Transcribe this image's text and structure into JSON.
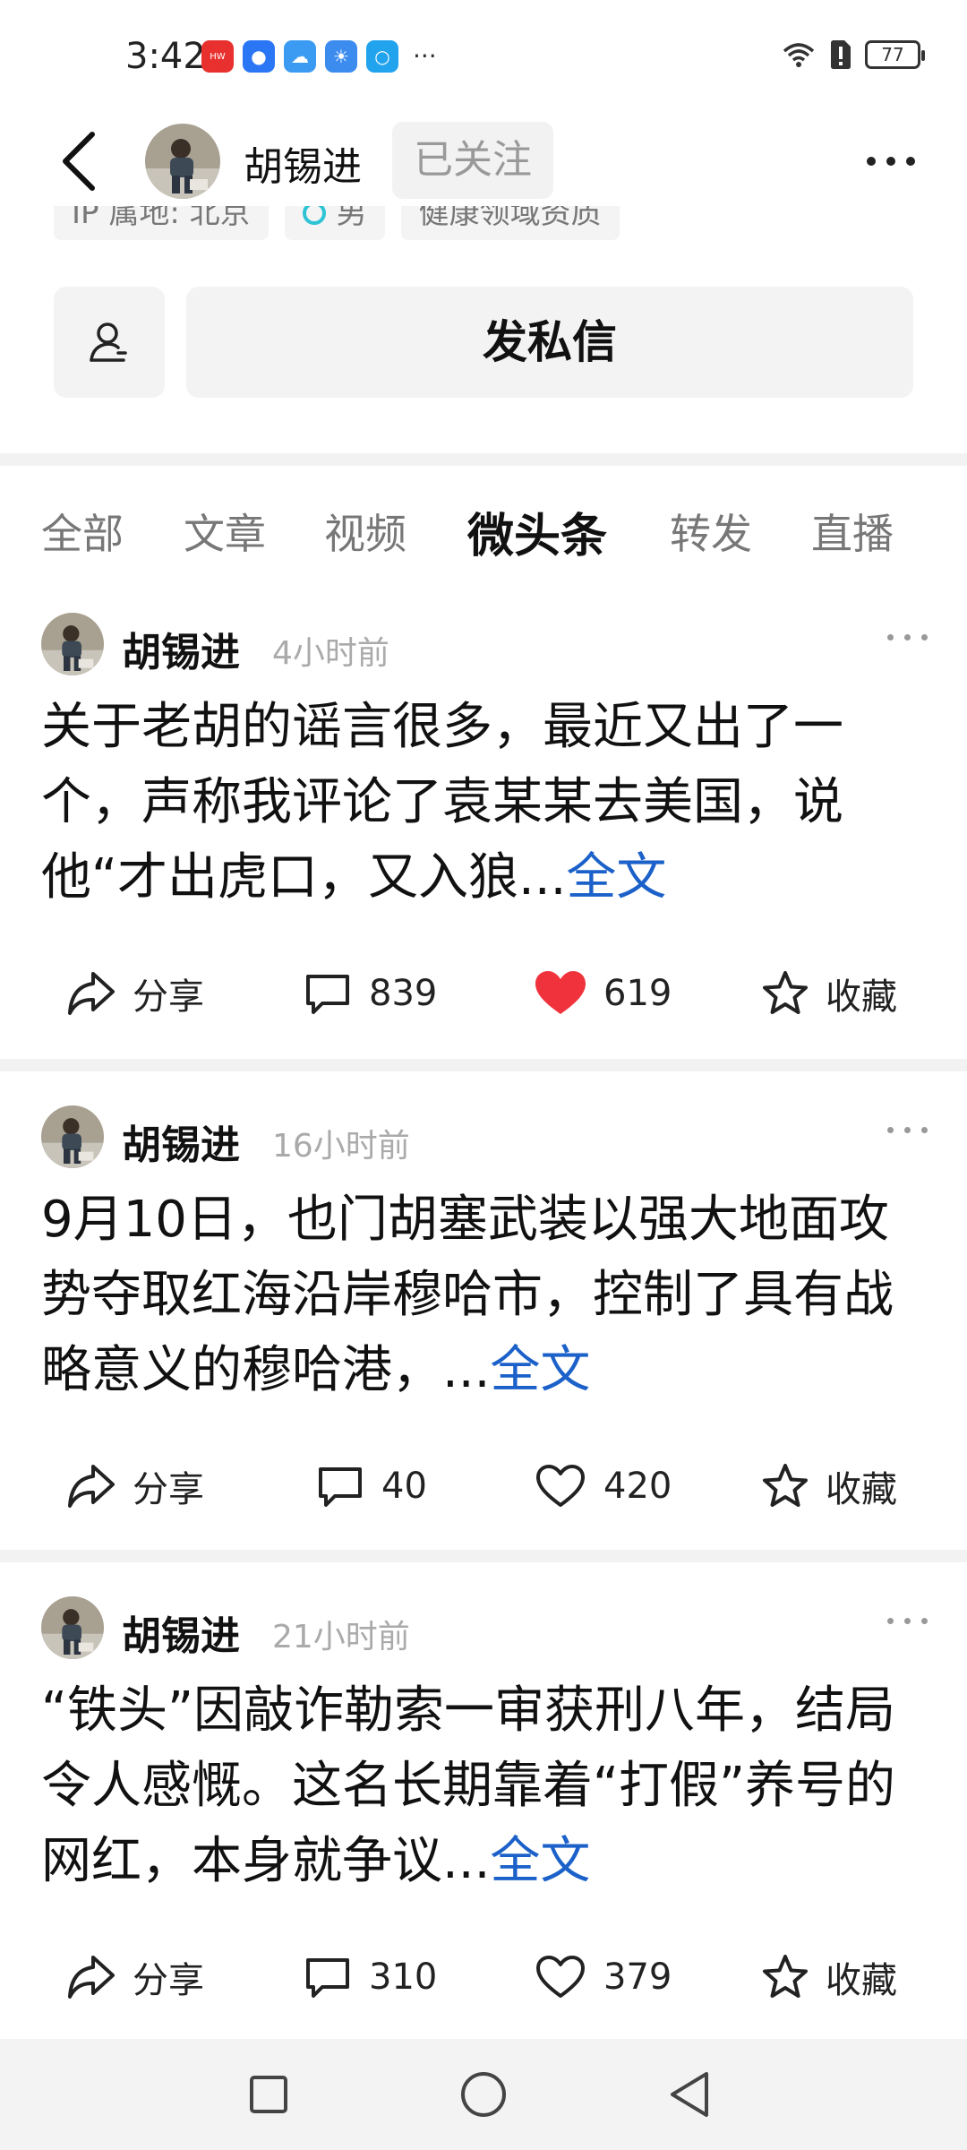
{
  "status_bar": {
    "time": "3:42",
    "battery": "77"
  },
  "header": {
    "name": "胡锡进",
    "follow_label": "已关注"
  },
  "profile_tags": [
    {
      "label": "IP 属地: 北京"
    },
    {
      "label": "男"
    },
    {
      "label": "健康领域资质"
    }
  ],
  "actions": {
    "message_label": "发私信"
  },
  "tabs": [
    {
      "label": "全部"
    },
    {
      "label": "文章"
    },
    {
      "label": "视频"
    },
    {
      "label": "微头条",
      "active": true
    },
    {
      "label": "转发"
    },
    {
      "label": "直播"
    }
  ],
  "posts": [
    {
      "author": "胡锡进",
      "time": "4小时前",
      "text": "关于老胡的谣言很多，最近又出了一个，声称我评论了袁某某去美国，说他“才出虎口，又入狼...",
      "fulltext_label": "全文",
      "share_label": "分享",
      "comments": "839",
      "likes": "619",
      "liked": true,
      "collect_label": "收藏"
    },
    {
      "author": "胡锡进",
      "time": "16小时前",
      "text": "9月10日，也门胡塞武装以强大地面攻势夺取红海沿岸穆哈市，控制了具有战略意义的穆哈港，...",
      "fulltext_label": "全文",
      "share_label": "分享",
      "comments": "40",
      "likes": "420",
      "liked": false,
      "collect_label": "收藏"
    },
    {
      "author": "胡锡进",
      "time": "21小时前",
      "text": "“铁头”因敲诈勒索一审获刑八年，结局令人感慨。这名长期靠着“打假”养号的网红，本身就争议...",
      "fulltext_label": "全文",
      "share_label": "分享",
      "comments": "310",
      "likes": "379",
      "liked": false,
      "collect_label": "收藏"
    }
  ],
  "colors": {
    "accent_link": "#1b61c9",
    "like_active": "#f0323c",
    "divider": "#f2f2f2"
  }
}
